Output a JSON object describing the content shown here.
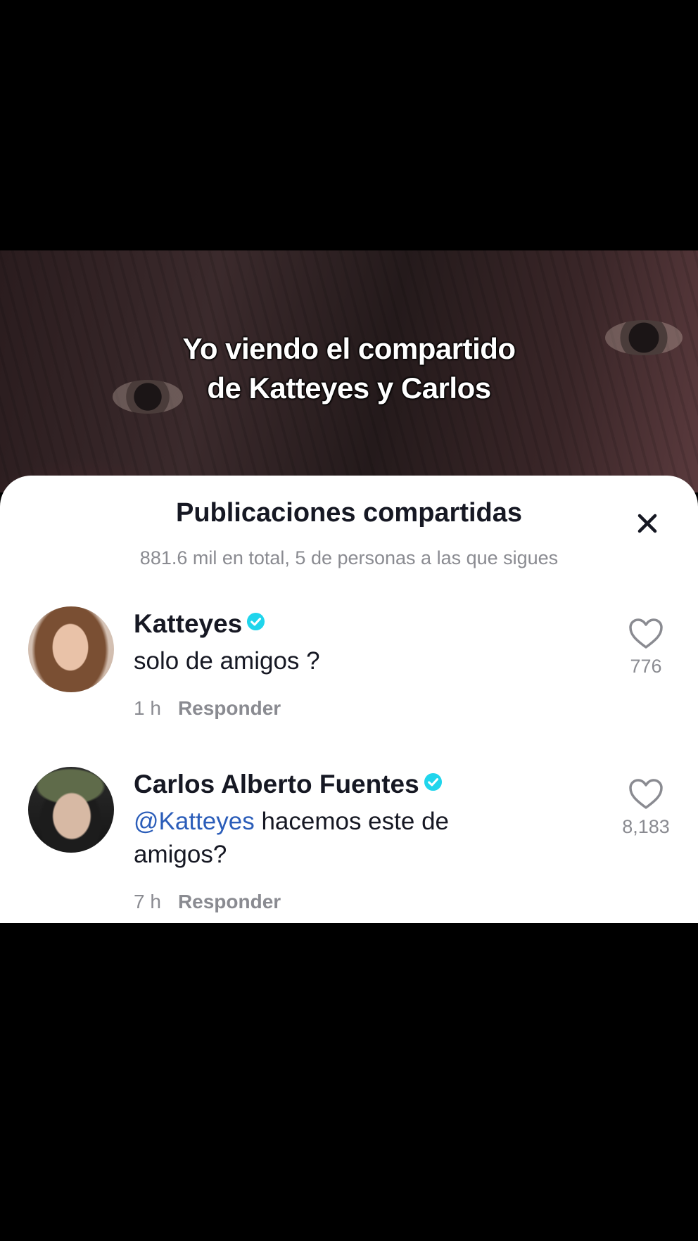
{
  "video": {
    "caption_line1": "Yo viendo el compartido",
    "caption_line2": "de Katteyes y Carlos"
  },
  "sheet": {
    "title": "Publicaciones compartidas",
    "subtitle": "881.6 mil en total, 5 de personas a las que sigues",
    "close_icon": "close-icon"
  },
  "comments": [
    {
      "username": "Katteyes",
      "verified": true,
      "mention": "",
      "text": "solo de amigos ?",
      "time": "1 h",
      "reply_label": "Responder",
      "likes": "776"
    },
    {
      "username": "Carlos Alberto Fuentes",
      "verified": true,
      "mention": "@Katteyes",
      "text": " hacemos este de amigos?",
      "time": "7 h",
      "reply_label": "Responder",
      "likes": "8,183"
    }
  ],
  "colors": {
    "verified_badge": "#20d5ec",
    "mention": "#2b5db9",
    "secondary_text": "#8a8b91",
    "primary_text": "#161823"
  }
}
